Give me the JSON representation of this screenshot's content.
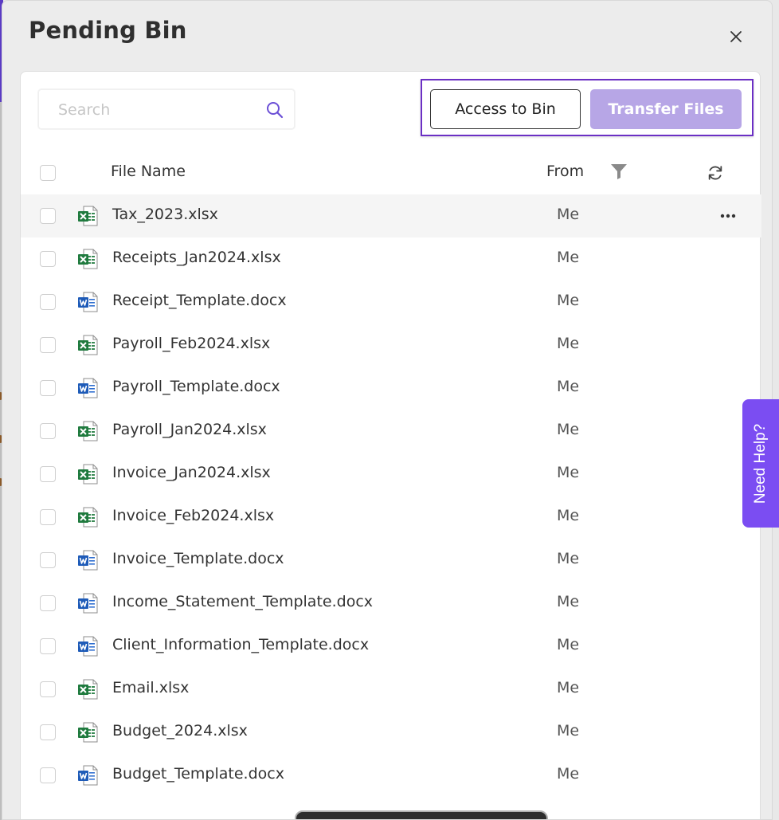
{
  "modal": {
    "title": "Pending Bin",
    "close_icon": "close-icon"
  },
  "search": {
    "placeholder": "Search",
    "value": "",
    "icon": "search-icon"
  },
  "actions": {
    "access_label": "Access to Bin",
    "transfer_label": "Transfer Files"
  },
  "table": {
    "columns": {
      "name": "File Name",
      "from": "From"
    },
    "icons": {
      "filter": "filter-icon",
      "refresh": "refresh-icon",
      "more": "more-icon"
    },
    "rows": [
      {
        "name": "Tax_2023.xlsx",
        "from": "Me",
        "type": "xlsx"
      },
      {
        "name": "Receipts_Jan2024.xlsx",
        "from": "Me",
        "type": "xlsx"
      },
      {
        "name": "Receipt_Template.docx",
        "from": "Me",
        "type": "docx"
      },
      {
        "name": "Payroll_Feb2024.xlsx",
        "from": "Me",
        "type": "xlsx"
      },
      {
        "name": "Payroll_Template.docx",
        "from": "Me",
        "type": "docx"
      },
      {
        "name": "Payroll_Jan2024.xlsx",
        "from": "Me",
        "type": "xlsx"
      },
      {
        "name": "Invoice_Jan2024.xlsx",
        "from": "Me",
        "type": "xlsx"
      },
      {
        "name": "Invoice_Feb2024.xlsx",
        "from": "Me",
        "type": "xlsx"
      },
      {
        "name": "Invoice_Template.docx",
        "from": "Me",
        "type": "docx"
      },
      {
        "name": "Income_Statement_Template.docx",
        "from": "Me",
        "type": "docx"
      },
      {
        "name": "Client_Information_Template.docx",
        "from": "Me",
        "type": "docx"
      },
      {
        "name": "Email.xlsx",
        "from": "Me",
        "type": "xlsx"
      },
      {
        "name": "Budget_2024.xlsx",
        "from": "Me",
        "type": "xlsx"
      },
      {
        "name": "Budget_Template.docx",
        "from": "Me",
        "type": "docx"
      }
    ]
  },
  "help_tab": {
    "label": "Need Help?"
  },
  "colors": {
    "accent": "#7b4df2",
    "transfer_button": "#b7a6e6",
    "highlight_border": "#6b2fc4",
    "excel_green": "#1f7a3e",
    "word_blue": "#1e5bb8"
  }
}
